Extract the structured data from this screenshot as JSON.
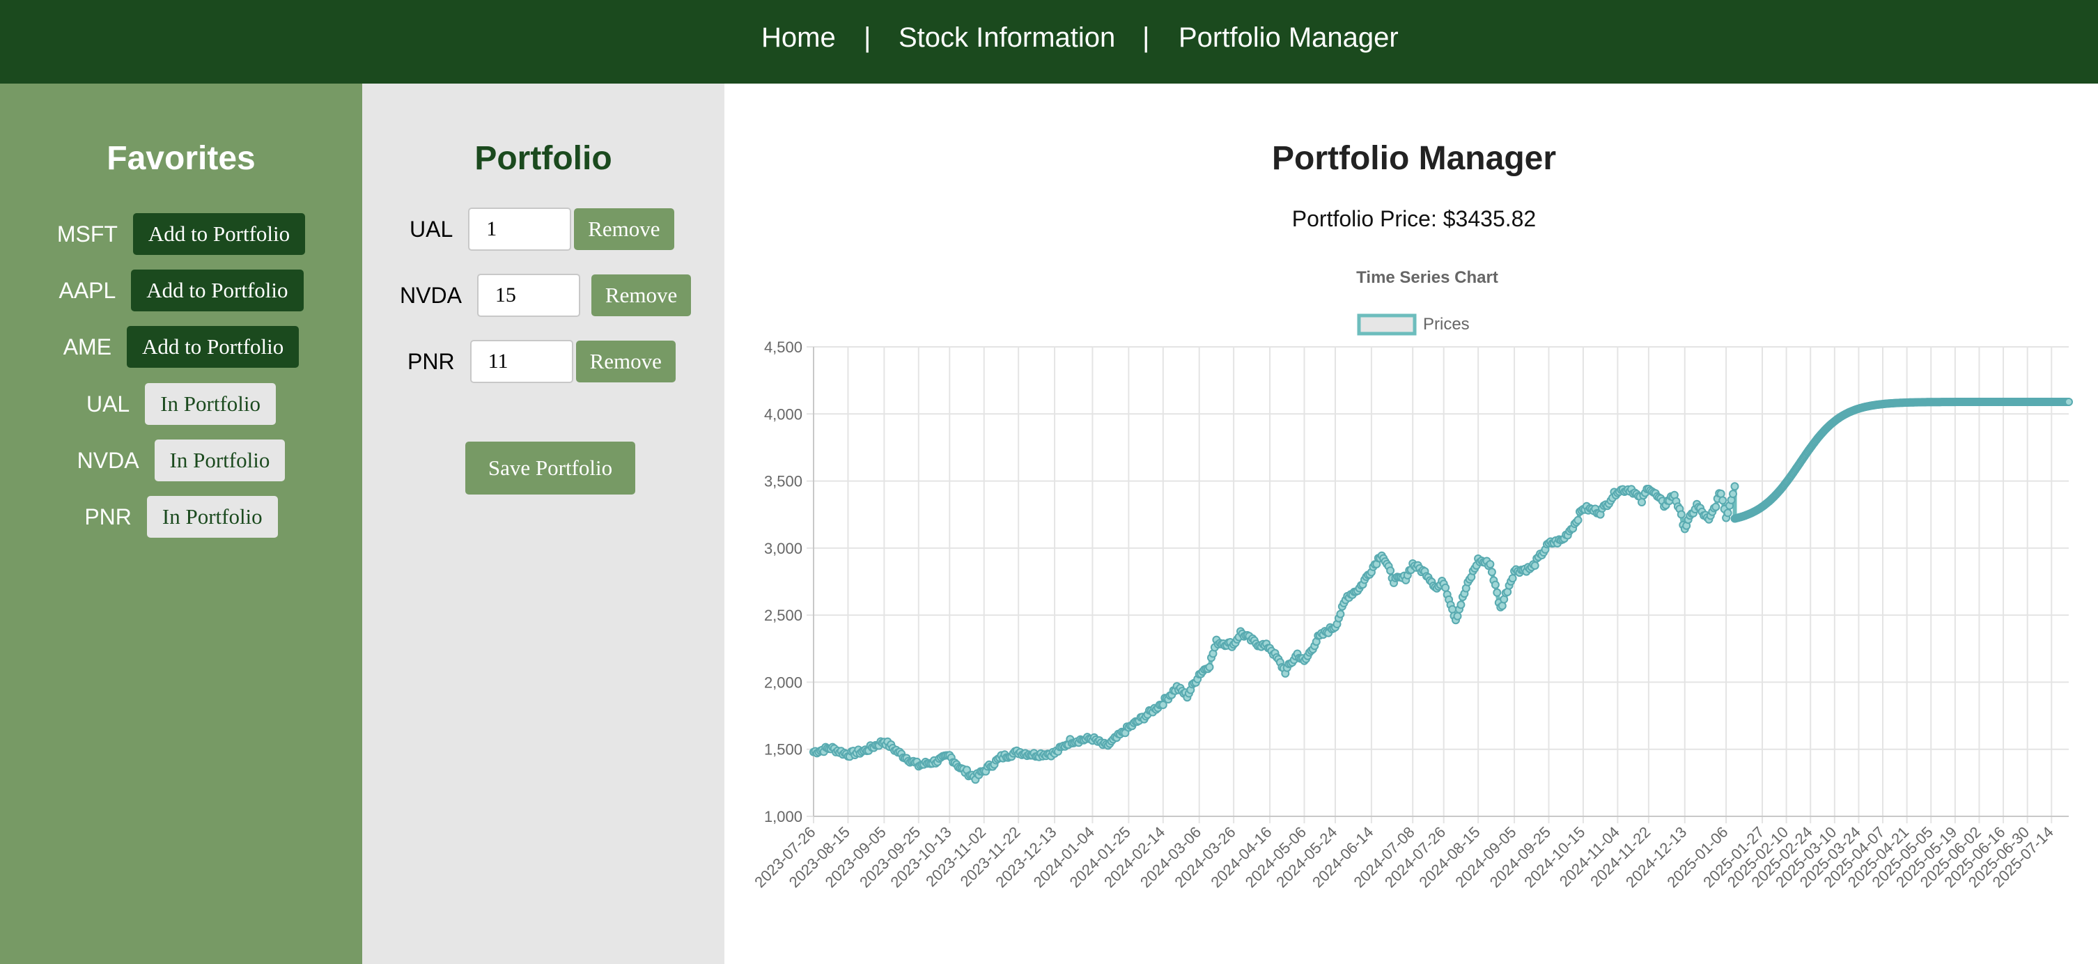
{
  "nav": {
    "home": "Home",
    "stock_info": "Stock Information",
    "portfolio_manager": "Portfolio Manager",
    "separator": "|"
  },
  "favorites": {
    "title": "Favorites",
    "items": [
      {
        "symbol": "MSFT",
        "action": "Add to Portfolio"
      },
      {
        "symbol": "AAPL",
        "action": "Add to Portfolio"
      },
      {
        "symbol": "AME",
        "action": "Add to Portfolio"
      },
      {
        "symbol": "UAL",
        "action": "In Portfolio"
      },
      {
        "symbol": "NVDA",
        "action": "In Portfolio"
      },
      {
        "symbol": "PNR",
        "action": "In Portfolio"
      }
    ]
  },
  "portfolio": {
    "title": "Portfolio",
    "items": [
      {
        "symbol": "UAL",
        "quantity": "1",
        "remove_label": "Remove"
      },
      {
        "symbol": "NVDA",
        "quantity": "15",
        "remove_label": "Remove"
      },
      {
        "symbol": "PNR",
        "quantity": "11",
        "remove_label": "Remove"
      }
    ],
    "save_label": "Save Portfolio"
  },
  "main": {
    "title": "Portfolio Manager",
    "price_text": "Portfolio Price: $3435.82"
  },
  "colors": {
    "nav_bg": "#1b4a1e",
    "favorites_bg": "#779a65",
    "portfolio_bg": "#e6e6e6",
    "series_line": "#6dbdbd",
    "series_point": "#58aab0"
  },
  "chart_data": {
    "type": "line",
    "title": "Time Series Chart",
    "legend": {
      "position": "top",
      "entries": [
        "Prices"
      ]
    },
    "series": [
      {
        "name": "Prices"
      }
    ],
    "ylim": [
      1000,
      4500
    ],
    "yticks": [
      "1,000",
      "1,500",
      "2,000",
      "2,500",
      "3,000",
      "3,500",
      "4,000",
      "4,500"
    ],
    "xticks": [
      "2023-07-26",
      "2023-08-15",
      "2023-09-05",
      "2023-09-25",
      "2023-10-13",
      "2023-11-02",
      "2023-11-22",
      "2023-12-13",
      "2024-01-04",
      "2024-01-25",
      "2024-02-14",
      "2024-03-06",
      "2024-03-26",
      "2024-04-16",
      "2024-05-06",
      "2024-05-24",
      "2024-06-14",
      "2024-07-08",
      "2024-07-26",
      "2024-08-15",
      "2024-09-05",
      "2024-09-25",
      "2024-10-15",
      "2024-11-04",
      "2024-11-22",
      "2024-12-13",
      "2025-01-06",
      "2025-01-27",
      "2025-02-10",
      "2025-02-24",
      "2025-03-10",
      "2025-03-24",
      "2025-04-07",
      "2025-04-21",
      "2025-05-05",
      "2025-05-19",
      "2025-06-02",
      "2025-06-16",
      "2025-06-30",
      "2025-07-14"
    ],
    "grid": true,
    "historical": [
      {
        "x": "2023-07-26",
        "y": 1480
      },
      {
        "x": "2023-08-05",
        "y": 1510
      },
      {
        "x": "2023-08-15",
        "y": 1460
      },
      {
        "x": "2023-08-25",
        "y": 1490
      },
      {
        "x": "2023-09-05",
        "y": 1560
      },
      {
        "x": "2023-09-15",
        "y": 1460
      },
      {
        "x": "2023-09-25",
        "y": 1380
      },
      {
        "x": "2023-10-05",
        "y": 1410
      },
      {
        "x": "2023-10-13",
        "y": 1450
      },
      {
        "x": "2023-10-20",
        "y": 1350
      },
      {
        "x": "2023-10-28",
        "y": 1290
      },
      {
        "x": "2023-11-02",
        "y": 1340
      },
      {
        "x": "2023-11-12",
        "y": 1440
      },
      {
        "x": "2023-11-22",
        "y": 1480
      },
      {
        "x": "2023-12-01",
        "y": 1460
      },
      {
        "x": "2023-12-13",
        "y": 1470
      },
      {
        "x": "2023-12-22",
        "y": 1560
      },
      {
        "x": "2024-01-04",
        "y": 1580
      },
      {
        "x": "2024-01-12",
        "y": 1520
      },
      {
        "x": "2024-01-25",
        "y": 1660
      },
      {
        "x": "2024-02-05",
        "y": 1760
      },
      {
        "x": "2024-02-14",
        "y": 1850
      },
      {
        "x": "2024-02-22",
        "y": 1960
      },
      {
        "x": "2024-02-28",
        "y": 1900
      },
      {
        "x": "2024-03-06",
        "y": 2060
      },
      {
        "x": "2024-03-12",
        "y": 2130
      },
      {
        "x": "2024-03-16",
        "y": 2300
      },
      {
        "x": "2024-03-26",
        "y": 2280
      },
      {
        "x": "2024-03-30",
        "y": 2370
      },
      {
        "x": "2024-04-08",
        "y": 2290
      },
      {
        "x": "2024-04-16",
        "y": 2260
      },
      {
        "x": "2024-04-25",
        "y": 2080
      },
      {
        "x": "2024-05-02",
        "y": 2210
      },
      {
        "x": "2024-05-06",
        "y": 2150
      },
      {
        "x": "2024-05-14",
        "y": 2330
      },
      {
        "x": "2024-05-24",
        "y": 2420
      },
      {
        "x": "2024-05-31",
        "y": 2640
      },
      {
        "x": "2024-06-07",
        "y": 2700
      },
      {
        "x": "2024-06-14",
        "y": 2840
      },
      {
        "x": "2024-06-20",
        "y": 2960
      },
      {
        "x": "2024-06-27",
        "y": 2760
      },
      {
        "x": "2024-07-04",
        "y": 2780
      },
      {
        "x": "2024-07-08",
        "y": 2880
      },
      {
        "x": "2024-07-16",
        "y": 2810
      },
      {
        "x": "2024-07-22",
        "y": 2700
      },
      {
        "x": "2024-07-26",
        "y": 2750
      },
      {
        "x": "2024-08-02",
        "y": 2470
      },
      {
        "x": "2024-08-08",
        "y": 2700
      },
      {
        "x": "2024-08-15",
        "y": 2910
      },
      {
        "x": "2024-08-22",
        "y": 2880
      },
      {
        "x": "2024-08-28",
        "y": 2550
      },
      {
        "x": "2024-09-05",
        "y": 2830
      },
      {
        "x": "2024-09-15",
        "y": 2850
      },
      {
        "x": "2024-09-25",
        "y": 3030
      },
      {
        "x": "2024-10-03",
        "y": 3060
      },
      {
        "x": "2024-10-10",
        "y": 3180
      },
      {
        "x": "2024-10-15",
        "y": 3300
      },
      {
        "x": "2024-10-25",
        "y": 3270
      },
      {
        "x": "2024-11-04",
        "y": 3430
      },
      {
        "x": "2024-11-12",
        "y": 3440
      },
      {
        "x": "2024-11-18",
        "y": 3350
      },
      {
        "x": "2024-11-22",
        "y": 3460
      },
      {
        "x": "2024-12-01",
        "y": 3320
      },
      {
        "x": "2024-12-07",
        "y": 3400
      },
      {
        "x": "2024-12-13",
        "y": 3150
      },
      {
        "x": "2024-12-20",
        "y": 3320
      },
      {
        "x": "2024-12-27",
        "y": 3200
      },
      {
        "x": "2025-01-03",
        "y": 3420
      },
      {
        "x": "2025-01-06",
        "y": 3230
      },
      {
        "x": "2025-01-11",
        "y": 3460
      }
    ],
    "forecast": {
      "start": {
        "x": "2025-01-11",
        "y": 3220
      },
      "plateau": 4090,
      "end": "2025-07-24"
    }
  }
}
